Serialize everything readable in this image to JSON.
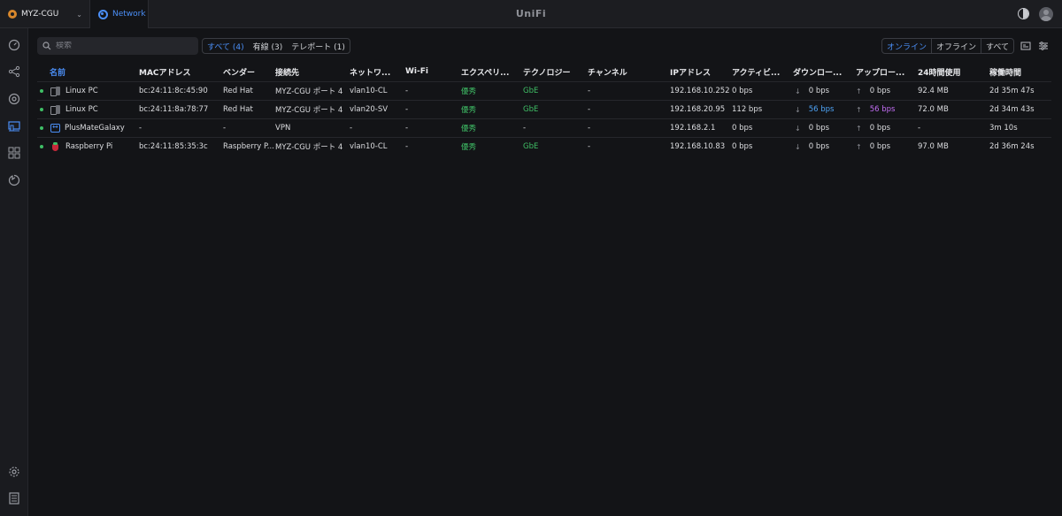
{
  "topbar": {
    "site_name": "MYZ-CGU",
    "app_tab": "Network",
    "brand": "UniFi"
  },
  "sidebar": {
    "items": [
      "dashboard-icon",
      "topology-icon",
      "devices-icon",
      "client-devices-icon",
      "apps-icon",
      "insights-icon",
      "settings-icon",
      "logs-icon"
    ]
  },
  "toolbar": {
    "search_placeholder": "検索",
    "filters": [
      "すべて (4)",
      "有線 (3)",
      "テレポート (1)"
    ],
    "status_filters": [
      "オンライン",
      "オフライン",
      "すべて"
    ]
  },
  "table": {
    "headers": [
      "名前",
      "MACアドレス",
      "ベンダー",
      "接続先",
      "ネットワ...",
      "Wi-Fi",
      "エクスペリ...",
      "テクノロジー",
      "チャンネル",
      "IPアドレス",
      "アクティビ...",
      "ダウンロー...",
      "アップロー...",
      "24時間使用",
      "稼働時間"
    ],
    "rows": [
      {
        "name": "Linux PC",
        "icon": "pc",
        "mac": "bc:24:11:8c:45:90",
        "vendor": "Red Hat",
        "uplink": "MYZ-CGU ポート 4",
        "network": "vlan10-CL",
        "wifi": "-",
        "experience": "優秀",
        "technology": "GbE",
        "channel": "-",
        "ip": "192.168.10.252",
        "activity": "0 bps",
        "download": "0 bps",
        "upload": "0 bps",
        "usage": "92.4 MB",
        "uptime": "2d 35m 47s",
        "dl_active": false,
        "ul_active": false
      },
      {
        "name": "Linux PC",
        "icon": "pc",
        "mac": "bc:24:11:8a:78:77",
        "vendor": "Red Hat",
        "uplink": "MYZ-CGU ポート 4",
        "network": "vlan20-SV",
        "wifi": "-",
        "experience": "優秀",
        "technology": "GbE",
        "channel": "-",
        "ip": "192.168.20.95",
        "activity": "112 bps",
        "download": "56 bps",
        "upload": "56 bps",
        "usage": "72.0 MB",
        "uptime": "2d 34m 43s",
        "dl_active": true,
        "ul_active": true
      },
      {
        "name": "PlusMateGalaxy",
        "icon": "vpn",
        "mac": "-",
        "vendor": "-",
        "uplink": "VPN",
        "network": "-",
        "wifi": "-",
        "experience": "優秀",
        "technology": "-",
        "channel": "-",
        "ip": "192.168.2.1",
        "activity": "0 bps",
        "download": "0 bps",
        "upload": "0 bps",
        "usage": "-",
        "uptime": "3m 10s",
        "dl_active": false,
        "ul_active": false
      },
      {
        "name": "Raspberry Pi",
        "icon": "rpi",
        "mac": "bc:24:11:85:35:3c",
        "vendor": "Raspberry P...",
        "uplink": "MYZ-CGU ポート 4",
        "network": "vlan10-CL",
        "wifi": "-",
        "experience": "優秀",
        "technology": "GbE",
        "channel": "-",
        "ip": "192.168.10.83",
        "activity": "0 bps",
        "download": "0 bps",
        "upload": "0 bps",
        "usage": "97.0 MB",
        "uptime": "2d 36m 24s",
        "dl_active": false,
        "ul_active": false
      }
    ]
  },
  "colors": {
    "accent": "#4b8ff7",
    "online": "#3fbf66",
    "download": "#4ea3f5",
    "upload": "#c36ef5"
  }
}
